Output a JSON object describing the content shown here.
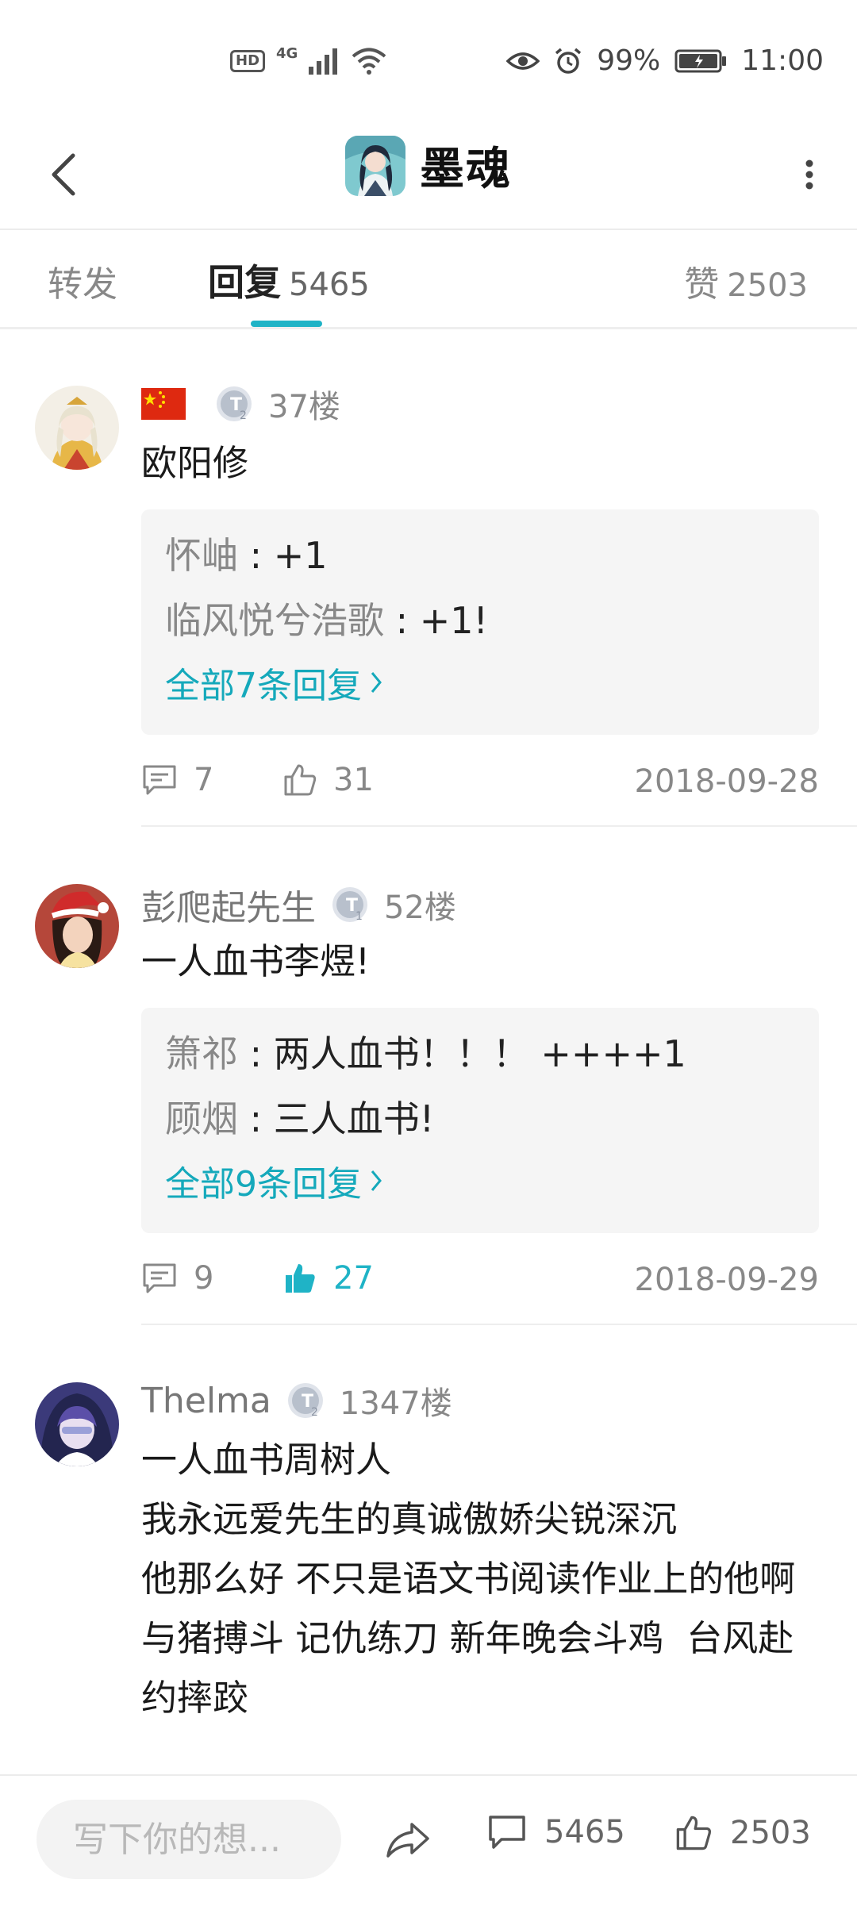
{
  "status_bar": {
    "hd": "HD",
    "network": "4G",
    "battery": "99%",
    "time": "11:00"
  },
  "header": {
    "title": "墨魂",
    "icons": {
      "back": "chevron-left-icon",
      "more": "vertical-ellipsis-icon",
      "app": "app-avatar-icon"
    }
  },
  "tabs": {
    "forward_label": "转发",
    "reply_label": "回复",
    "reply_count": "5465",
    "likes_label": "赞",
    "likes_count": "2503",
    "accent": "#1fb3c6"
  },
  "comments": [
    {
      "username": "",
      "level": "2",
      "floor": "37楼",
      "content": "欧阳修",
      "replies": [
        {
          "name": "怀岫",
          "text": " : +1"
        },
        {
          "name": "临风悦兮浩歌",
          "text": " : +1!"
        }
      ],
      "view_all": "全部7条回复",
      "comment_count": "7",
      "like_count": "31",
      "liked": false,
      "date": "2018-09-28"
    },
    {
      "username": "彭爬起先生",
      "level": "1",
      "floor": "52楼",
      "content": "一人血书李煜!",
      "replies": [
        {
          "name": "箫祁",
          "text": " : 两人血书！！！ ++++1"
        },
        {
          "name": "顾烟",
          "text": " : 三人血书!"
        }
      ],
      "view_all": "全部9条回复",
      "comment_count": "9",
      "like_count": "27",
      "liked": true,
      "date": "2018-09-29"
    },
    {
      "username": "Thelma",
      "level": "2",
      "floor": "1347楼",
      "content": "一人血书周树人\n我永远爱先生的真诚傲娇尖锐深沉\n他那么好 不只是语文书阅读作业上的他啊\n与猪搏斗 记仇练刀 新年晚会斗鸡  台风赴约摔跤"
    }
  ],
  "bottom_bar": {
    "input_placeholder": "写下你的想...",
    "comment_count": "5465",
    "like_count": "2503"
  }
}
